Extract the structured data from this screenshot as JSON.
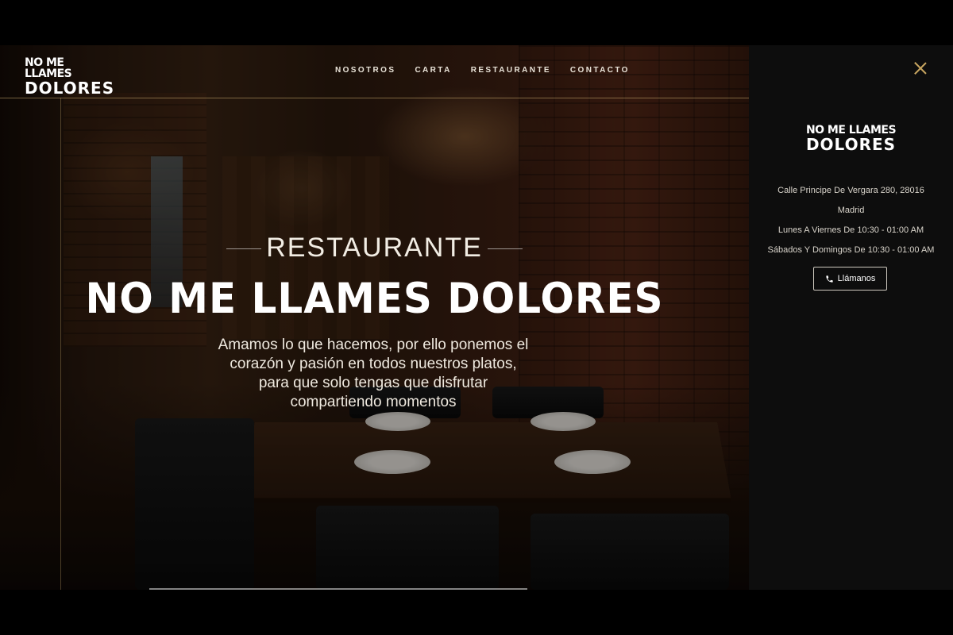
{
  "logo": {
    "line1": "NO ME LLAMES",
    "line2": "DOLORES"
  },
  "nav": {
    "items": [
      {
        "label": "NOSOTROS"
      },
      {
        "label": "CARTA"
      },
      {
        "label": "RESTAURANTE"
      },
      {
        "label": "CONTACTO"
      }
    ]
  },
  "hero": {
    "eyebrow": "RESTAURANTE",
    "headline": "NO ME LLAMES DOLORES",
    "tagline": "Amamos lo que hacemos, por ello ponemos el corazón y pasión en todos nuestros platos, para que solo tengas que disfrutar compartiendo momentos"
  },
  "side_panel": {
    "logo": {
      "line1": "NO ME LLAMES",
      "line2": "DOLORES"
    },
    "address_line1": "Calle Principe De Vergara 280, 28016",
    "address_line2": "Madrid",
    "hours_weekdays": "Lunes A Viernes De 10:30 - 01:00 AM",
    "hours_weekend": "Sábados Y Domingos De 10:30 - 01:00 AM",
    "call_button": "Llámanos",
    "icons": {
      "close": "close-icon",
      "phone": "phone-icon"
    }
  },
  "colors": {
    "accent_gold": "#c8a560",
    "panel_bg": "#0d0d0d",
    "text_light": "#efe9df"
  }
}
